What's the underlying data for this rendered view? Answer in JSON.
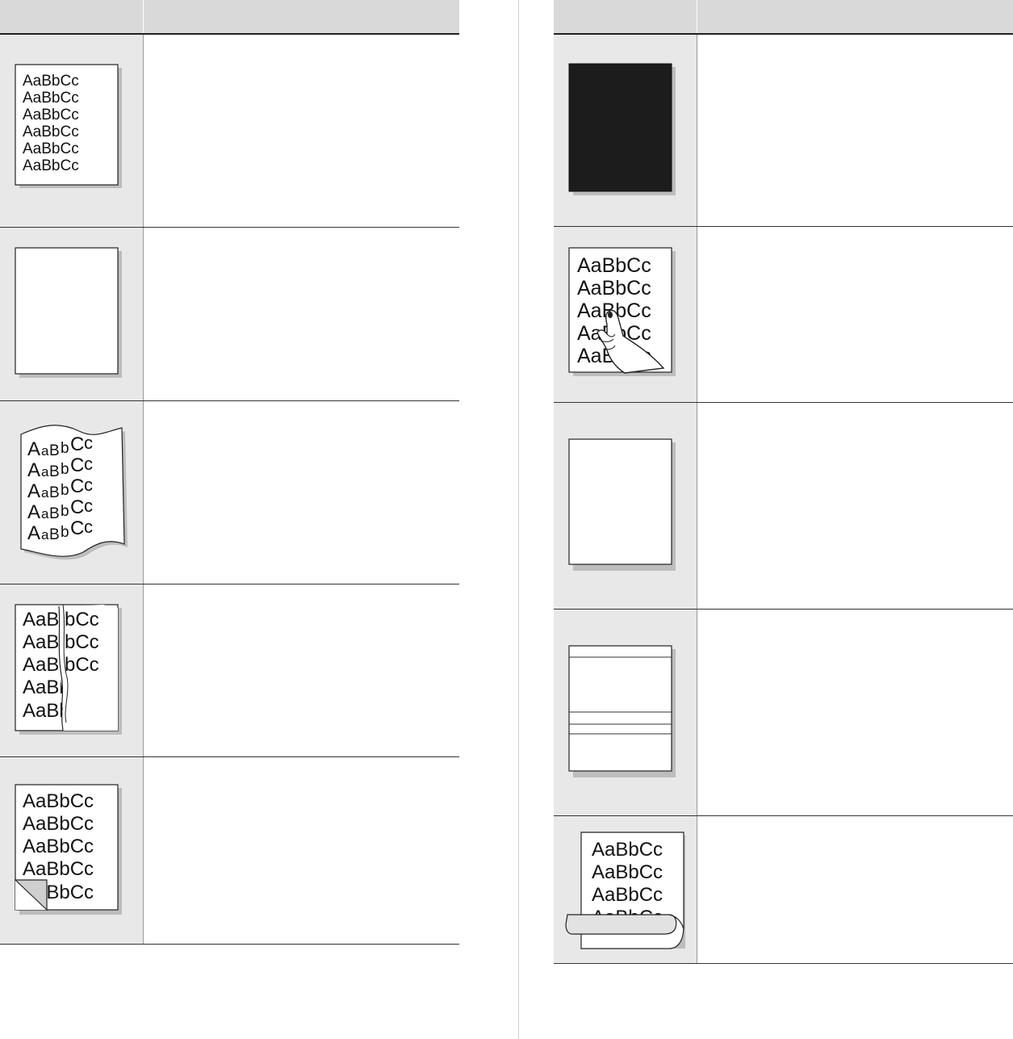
{
  "sample_text": "AaBbCc",
  "wavy_text": {
    "a1": "A",
    "a2": "a",
    "b1": "B",
    "b2": "b",
    "c1": "C",
    "c2": "c"
  },
  "torn_text": {
    "left": "AaB",
    "right": "bCc"
  },
  "left_table": {
    "header": {
      "col1": "",
      "col2": ""
    },
    "rows": [
      {
        "image": "light-print-page",
        "description": ""
      },
      {
        "image": "blank-page",
        "description": ""
      },
      {
        "image": "wavy-page",
        "description": ""
      },
      {
        "image": "torn-page",
        "description": ""
      },
      {
        "image": "folded-corner-page",
        "description": ""
      }
    ]
  },
  "right_table": {
    "header": {
      "col1": "",
      "col2": ""
    },
    "rows": [
      {
        "image": "black-page",
        "description": ""
      },
      {
        "image": "smudged-hand-page",
        "description": ""
      },
      {
        "image": "blank-page",
        "description": ""
      },
      {
        "image": "horizontal-lines-page",
        "description": ""
      },
      {
        "image": "curled-page",
        "description": ""
      }
    ]
  }
}
